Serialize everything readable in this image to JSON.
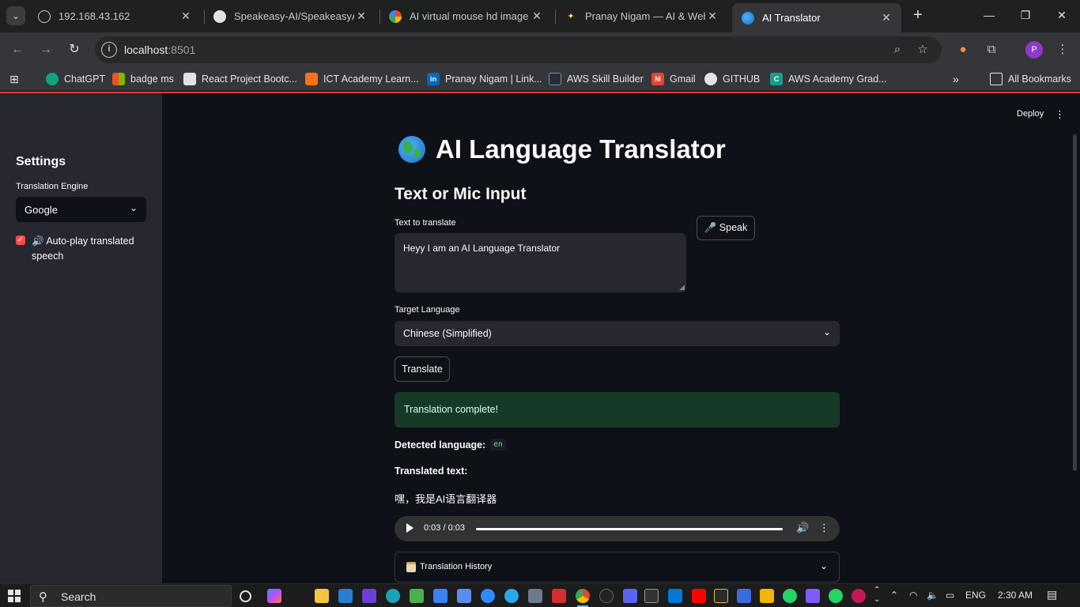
{
  "browser": {
    "tabs": [
      {
        "title": "192.168.43.162",
        "icon": "globe-icon",
        "active": false
      },
      {
        "title": "Speakeasy-AI/SpeakeasyAI.p",
        "icon": "github-icon",
        "active": false
      },
      {
        "title": "AI virtual mouse hd image -",
        "icon": "google-icon",
        "active": false
      },
      {
        "title": "Pranay Nigam — AI & Web I",
        "icon": "sparkle-icon",
        "active": false
      },
      {
        "title": "AI Translator",
        "icon": "streamlit-globe-icon",
        "active": true
      }
    ],
    "url_host": "localhost",
    "url_port": ":8501",
    "profile_initial": "P",
    "bookmarks": [
      {
        "label": "ChatGPT",
        "icon": "chatgpt-icon",
        "color": "#10a37f"
      },
      {
        "label": "badge ms",
        "icon": "microsoft-icon",
        "color": "#f25022"
      },
      {
        "label": "React Project Bootc...",
        "icon": "doc-icon",
        "color": "#ffffff"
      },
      {
        "label": "ICT Academy Learn...",
        "icon": "ict-icon",
        "color": "#f97316"
      },
      {
        "label": "Pranay Nigam | Link...",
        "icon": "linkedin-icon",
        "color": "#0a66c2"
      },
      {
        "label": "AWS Skill Builder",
        "icon": "aws-icon",
        "color": "#232f3e"
      },
      {
        "label": "Gmail",
        "icon": "gmail-icon",
        "color": "#ea4335"
      },
      {
        "label": "GITHUB",
        "icon": "github-icon",
        "color": "#ffffff"
      },
      {
        "label": "AWS Academy Grad...",
        "icon": "c-icon",
        "color": "#1a9c8c"
      }
    ],
    "all_bookmarks": "All Bookmarks"
  },
  "app": {
    "deploy": "Deploy",
    "sidebar": {
      "title": "Settings",
      "engine_label": "Translation Engine",
      "engine_value": "Google",
      "autoplay_label": "🔊 Auto-play translated speech",
      "autoplay_checked": true
    },
    "main": {
      "title": "AI Language Translator",
      "subheader": "Text or Mic Input",
      "text_label": "Text to translate",
      "text_value": "Heyy I am an AI Language Translator",
      "speak_button": "🎤 Speak",
      "target_label": "Target Language",
      "target_value": "Chinese (Simplified)",
      "translate_button": "Translate",
      "success_message": "Translation complete!",
      "detected_label": "Detected language:",
      "detected_value": "en",
      "translated_label": "Translated text:",
      "translated_value": "嘿，我是AI语言翻译器",
      "audio_time": "0:03 / 0:03",
      "audio_progress": 1.0,
      "history_label": "Translation History"
    }
  },
  "taskbar": {
    "search_placeholder": "Search",
    "language": "ENG",
    "time": "2:30 AM"
  },
  "colors": {
    "accent": "#ff4b4b",
    "success_bg": "#173928",
    "sidebar_bg": "#262730",
    "app_bg": "#0e1117"
  }
}
